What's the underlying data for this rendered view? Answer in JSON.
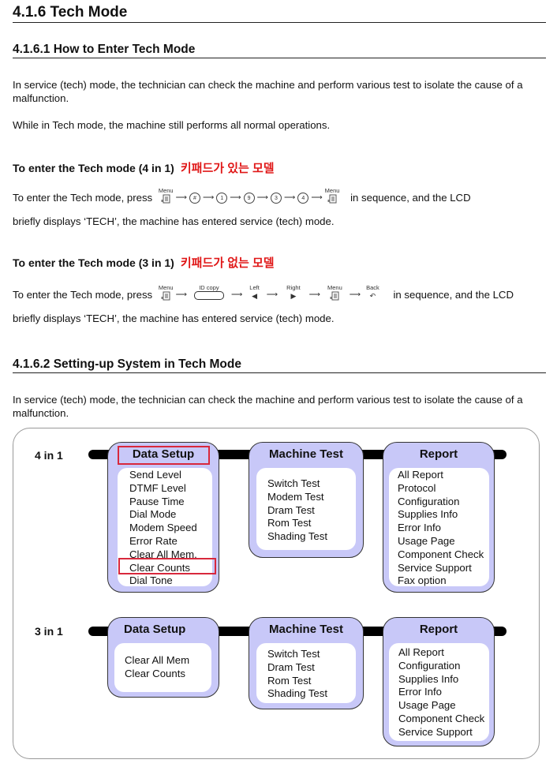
{
  "heading_main": "4.1.6 Tech Mode",
  "section1": {
    "heading": "4.1.6.1 How to Enter Tech Mode",
    "intro": "In service (tech) mode, the technician can check the machine and perform various test to isolate the cause of a malfunction.",
    "note": "While in Tech mode, the machine still performs all normal operations.",
    "four_in_one": {
      "title": "To enter the Tech mode (4 in 1)",
      "korean_note": "키패드가 있는 모델",
      "press_prefix": "To enter the Tech mode, press",
      "press_suffix": "in sequence, and the LCD",
      "line2": "briefly displays ‘TECH’, the machine has entered service (tech) mode.",
      "keys": [
        {
          "label": "Menu",
          "icon": "menu-icon"
        },
        {
          "label": "",
          "icon": "hash-key",
          "text": "#"
        },
        {
          "label": "",
          "icon": "digit-key",
          "text": "1"
        },
        {
          "label": "",
          "icon": "digit-key",
          "text": "9"
        },
        {
          "label": "",
          "icon": "digit-key",
          "text": "3"
        },
        {
          "label": "",
          "icon": "digit-key",
          "text": "4"
        },
        {
          "label": "Menu",
          "icon": "menu-icon"
        }
      ]
    },
    "three_in_one": {
      "title": "To enter the Tech mode (3 in 1)",
      "korean_note": "키패드가 없는 모델",
      "press_prefix": "To enter the Tech mode, press",
      "press_suffix": "in sequence, and the LCD",
      "line2": "briefly displays ‘TECH’, the machine has entered service (tech) mode.",
      "keys": [
        {
          "label": "Menu",
          "icon": "menu-icon"
        },
        {
          "label": "ID copy",
          "icon": "id-copy-button"
        },
        {
          "label": "Left",
          "icon": "left-arrow-icon",
          "text": "◀"
        },
        {
          "label": "Right",
          "icon": "right-arrow-icon",
          "text": "▶"
        },
        {
          "label": "Menu",
          "icon": "menu-icon"
        },
        {
          "label": "Back",
          "icon": "back-icon",
          "text": "↶"
        }
      ]
    }
  },
  "section2": {
    "heading": "4.1.6.2 Setting-up System in Tech Mode",
    "intro": "In service (tech) mode, the technician can check the machine and perform various test to isolate the cause of a malfunction.",
    "diagram": {
      "row_4in1": {
        "label": "4 in 1",
        "data_setup": {
          "title": "Data Setup",
          "items": [
            "Send Level",
            "DTMF Level",
            "Pause Time",
            "Dial Mode",
            "Modem Speed",
            "Error Rate",
            "Clear All Mem.",
            "Clear Counts",
            "Dial Tone"
          ]
        },
        "machine_test": {
          "title": "Machine Test",
          "items": [
            "Switch Test",
            "Modem Test",
            "Dram Test",
            "Rom Test",
            "Shading Test"
          ]
        },
        "report": {
          "title": "Report",
          "items": [
            "All Report",
            "Protocol",
            "Configuration",
            "Supplies Info",
            "Error Info",
            "Usage Page",
            "Component Check",
            "Service Support",
            "Fax option"
          ]
        }
      },
      "row_3in1": {
        "label": "3 in 1",
        "data_setup": {
          "title": "Data Setup",
          "items": [
            "Clear All Mem",
            "Clear Counts"
          ]
        },
        "machine_test": {
          "title": "Machine Test",
          "items": [
            "Switch Test",
            "Dram Test",
            "Rom Test",
            "Shading Test"
          ]
        },
        "report": {
          "title": "Report",
          "items": [
            "All Report",
            "Configuration",
            "Supplies Info",
            "Error Info",
            "Usage Page",
            "Component Check",
            "Service Support"
          ]
        }
      },
      "highlight_color": "#d8283c",
      "box_color": "#c8c8f8"
    }
  }
}
